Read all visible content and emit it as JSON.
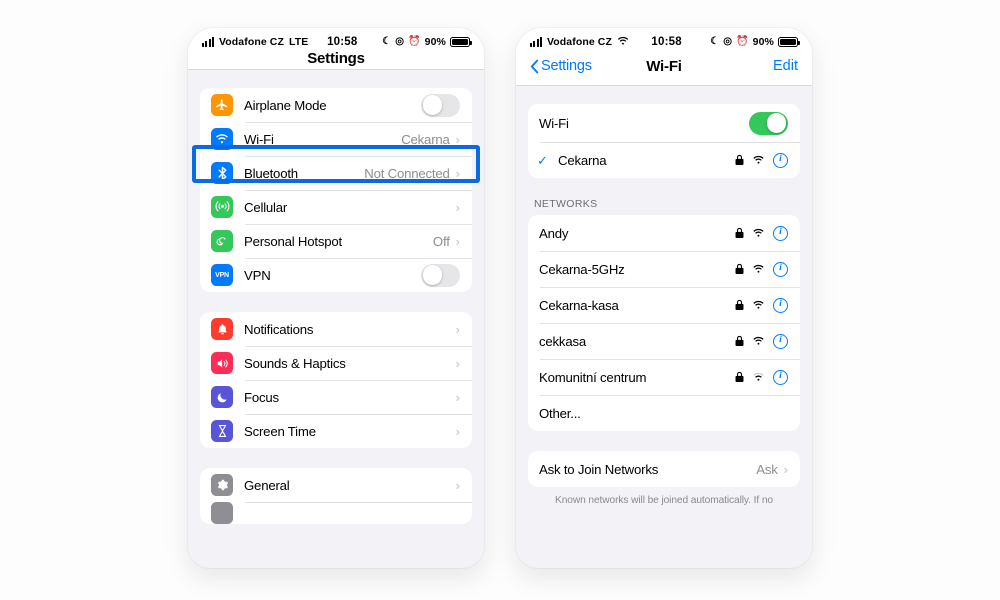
{
  "left_phone": {
    "status_bar": {
      "carrier": "Vodafone CZ",
      "network_type": "LTE",
      "time": "10:58",
      "battery_percent": "90%",
      "icons": [
        "signal-bars-icon",
        "moon-icon",
        "location-icon",
        "alarm-icon",
        "battery-icon"
      ]
    },
    "nav": {
      "title": "Settings"
    },
    "group1": [
      {
        "icon": "airplane-icon",
        "icon_color": "#ff9500",
        "label": "Airplane Mode",
        "control": "toggle",
        "toggle_on": false
      },
      {
        "icon": "wifi-icon",
        "icon_color": "#007aff",
        "label": "Wi-Fi",
        "value": "Cekarna",
        "control": "chevron",
        "highlighted": true
      },
      {
        "icon": "bluetooth-icon",
        "icon_color": "#007aff",
        "label": "Bluetooth",
        "value": "Not Connected",
        "control": "chevron"
      },
      {
        "icon": "cellular-icon",
        "icon_color": "#34c759",
        "label": "Cellular",
        "value": "",
        "control": "chevron"
      },
      {
        "icon": "hotspot-icon",
        "icon_color": "#34c759",
        "label": "Personal Hotspot",
        "value": "Off",
        "control": "chevron"
      },
      {
        "icon": "vpn-icon",
        "icon_color": "#007aff",
        "label": "VPN",
        "control": "toggle",
        "toggle_on": false
      }
    ],
    "group2": [
      {
        "icon": "bell-icon",
        "icon_color": "#ff3b30",
        "label": "Notifications",
        "control": "chevron"
      },
      {
        "icon": "speaker-icon",
        "icon_color": "#fc2d55",
        "label": "Sounds & Haptics",
        "control": "chevron"
      },
      {
        "icon": "moon-icon",
        "icon_color": "#5856d6",
        "label": "Focus",
        "control": "chevron"
      },
      {
        "icon": "hourglass-icon",
        "icon_color": "#5856d6",
        "label": "Screen Time",
        "control": "chevron"
      }
    ],
    "group3": [
      {
        "icon": "gear-icon",
        "icon_color": "#8e8e93",
        "label": "General",
        "control": "chevron"
      }
    ]
  },
  "right_phone": {
    "status_bar": {
      "carrier": "Vodafone CZ",
      "network_type": "wifi-icon",
      "time": "10:58",
      "battery_percent": "90%"
    },
    "nav": {
      "back_label": "Settings",
      "title": "Wi-Fi",
      "edit_label": "Edit"
    },
    "wifi_toggle": {
      "label": "Wi-Fi",
      "on": true
    },
    "connected_network": {
      "name": "Cekarna",
      "checked": true,
      "secured": true
    },
    "networks_header": "NETWORKS",
    "networks": [
      {
        "name": "Andy",
        "secured": true,
        "signal": 3
      },
      {
        "name": "Cekarna-5GHz",
        "secured": true,
        "signal": 3
      },
      {
        "name": "Cekarna-kasa",
        "secured": true,
        "signal": 3
      },
      {
        "name": "cekkasa",
        "secured": true,
        "signal": 3
      },
      {
        "name": "Komunitní centrum",
        "secured": true,
        "signal": 2
      },
      {
        "name": "Other...",
        "secured": false,
        "signal": 0
      }
    ],
    "ask_to_join": {
      "label": "Ask to Join Networks",
      "value": "Ask"
    },
    "footnote": "Known networks will be joined automatically. If no"
  },
  "colors": {
    "highlight_blue": "#0a6ae1",
    "ios_blue": "#007aff",
    "ios_green": "#34c759",
    "background": "#f2f2f7"
  }
}
